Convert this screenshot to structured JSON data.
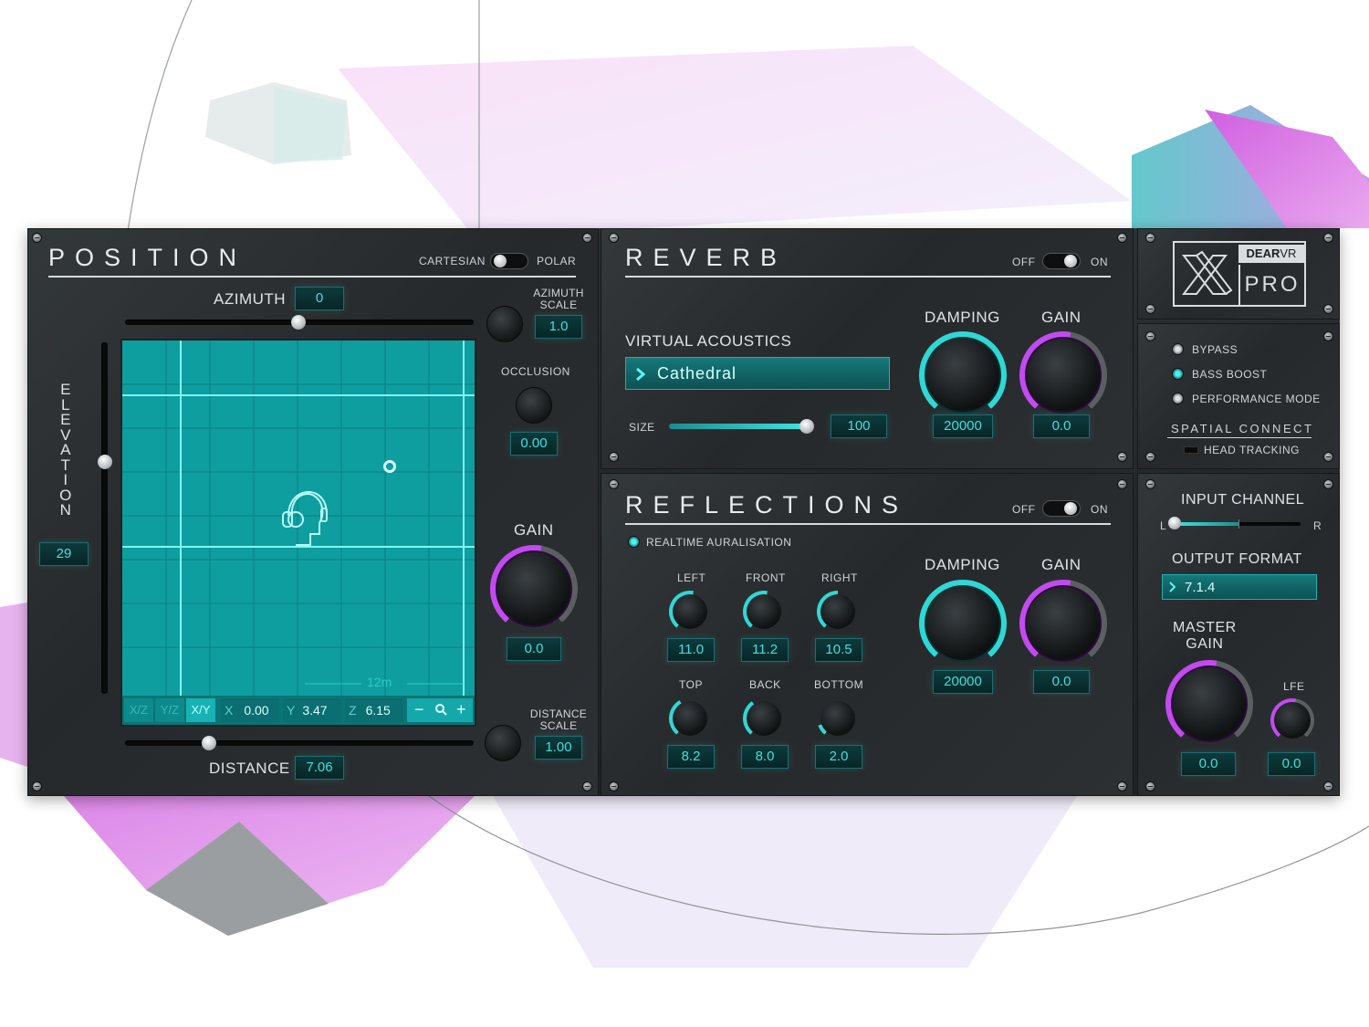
{
  "position": {
    "title": "POSITION",
    "mode_left": "CARTESIAN",
    "mode_right": "POLAR",
    "azimuth_label": "AZIMUTH",
    "azimuth_value": "0",
    "azimuth_scale_label": "AZIMUTH\nSCALE",
    "azimuth_scale_value": "1.0",
    "elevation_label": "ELEVATION",
    "elevation_value": "29",
    "occlusion_label": "OCCLUSION",
    "occlusion_value": "0.00",
    "gain_label": "GAIN",
    "gain_value": "0.0",
    "distance_label": "DISTANCE",
    "distance_value": "7.06",
    "distance_scale_label": "DISTANCE\nSCALE",
    "distance_scale_value": "1.00",
    "grid_scale": "12m",
    "view_tabs": [
      "X/Z",
      "Y/Z",
      "X/Y"
    ],
    "coords": {
      "x_label": "X",
      "x": "0.00",
      "y_label": "Y",
      "y": "3.47",
      "z_label": "Z",
      "z": "6.15"
    },
    "zoom_out": "−",
    "zoom_in": "+"
  },
  "reverb": {
    "title": "REVERB",
    "off": "OFF",
    "on": "ON",
    "virtual_acoustics_label": "VIRTUAL ACOUSTICS",
    "preset": "Cathedral",
    "size_label": "SIZE",
    "size_value": "100",
    "damping_label": "DAMPING",
    "damping_value": "20000",
    "gain_label": "GAIN",
    "gain_value": "0.0"
  },
  "reflections": {
    "title": "REFLECTIONS",
    "off": "OFF",
    "on": "ON",
    "realtime_label": "REALTIME AURALISATION",
    "left_label": "LEFT",
    "left_value": "11.0",
    "front_label": "FRONT",
    "front_value": "11.2",
    "right_label": "RIGHT",
    "right_value": "10.5",
    "top_label": "TOP",
    "top_value": "8.2",
    "back_label": "BACK",
    "back_value": "8.0",
    "bottom_label": "BOTTOM",
    "bottom_value": "2.0",
    "damping_label": "DAMPING",
    "damping_value": "20000",
    "gain_label": "GAIN",
    "gain_value": "0.0"
  },
  "brand": {
    "dear": "DEAR",
    "vr": "VR",
    "pro": "PRO"
  },
  "options": {
    "bypass": "BYPASS",
    "bass_boost": "BASS BOOST",
    "performance_mode": "PERFORMANCE MODE",
    "spatial_connect": "SPATIAL CONNECT",
    "head_tracking": "HEAD TRACKING"
  },
  "output": {
    "input_channel_label": "INPUT CHANNEL",
    "left": "L",
    "right": "R",
    "output_format_label": "OUTPUT FORMAT",
    "output_format_value": "7.1.4",
    "master_gain_label": "MASTER\nGAIN",
    "master_gain_value": "0.0",
    "lfe_label": "LFE",
    "lfe_value": "0.0"
  },
  "colors": {
    "accent": "#3fe0dd",
    "purple": "#c24bf0",
    "grid": "#0e9ea0"
  }
}
